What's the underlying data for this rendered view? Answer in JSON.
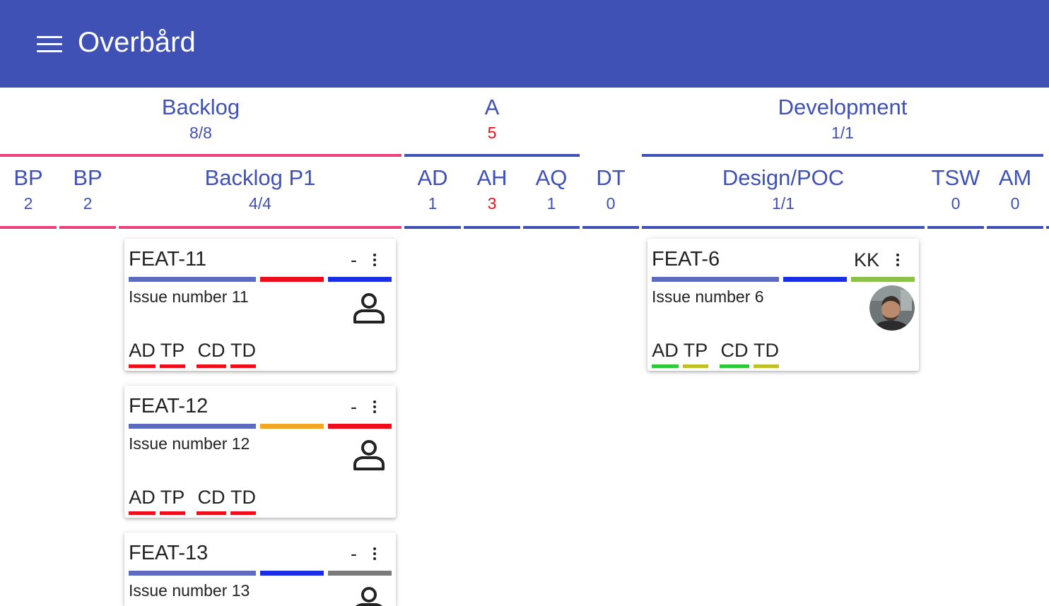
{
  "app": {
    "title": "Overbård",
    "menu_icon": "menu-icon"
  },
  "colors": {
    "primary": "#3f51b5",
    "header_text": "#ffffff",
    "backlog_accent": "#ec407a",
    "alert_red": "#f10c1c"
  },
  "groups": [
    {
      "name": "Backlog",
      "count": "8/8"
    },
    {
      "name": "A",
      "count": "5"
    },
    {
      "name": "Development",
      "count": "1/1"
    }
  ],
  "columns": [
    {
      "name": "BP",
      "count": "2"
    },
    {
      "name": "BP",
      "count": "2"
    },
    {
      "name": "Backlog P1",
      "count": "4/4"
    },
    {
      "name": "AD",
      "count": "1"
    },
    {
      "name": "AH",
      "count": "3"
    },
    {
      "name": "AQ",
      "count": "1"
    },
    {
      "name": "DT",
      "count": "0"
    },
    {
      "name": "Design/POC",
      "count": "1/1"
    },
    {
      "name": "TSW",
      "count": "0"
    },
    {
      "name": "AM",
      "count": "0"
    }
  ],
  "cards": [
    {
      "id": "FEAT-11",
      "assignee": "-",
      "description": "Issue number 11",
      "avatar": "person-icon",
      "bar_colors": [
        "#5c6bc0",
        "#f10c1c",
        "#1a2ee8"
      ],
      "tasks": [
        {
          "label": "AD",
          "color": "#f10c1c"
        },
        {
          "label": "TP",
          "color": "#f10c1c"
        },
        {
          "label": "CD",
          "color": "#f10c1c"
        },
        {
          "label": "TD",
          "color": "#f10c1c"
        }
      ]
    },
    {
      "id": "FEAT-12",
      "assignee": "-",
      "description": "Issue number 12",
      "avatar": "person-icon",
      "bar_colors": [
        "#5c6bc0",
        "#f5a524",
        "#f10c1c"
      ],
      "tasks": [
        {
          "label": "AD",
          "color": "#f10c1c"
        },
        {
          "label": "TP",
          "color": "#f10c1c"
        },
        {
          "label": "CD",
          "color": "#f10c1c"
        },
        {
          "label": "TD",
          "color": "#f10c1c"
        }
      ]
    },
    {
      "id": "FEAT-13",
      "assignee": "-",
      "description": "Issue number 13",
      "avatar": "person-icon",
      "bar_colors": [
        "#5c6bc0",
        "#1a2ee8",
        "#7b7b7b"
      ]
    },
    {
      "id": "FEAT-6",
      "assignee": "KK",
      "description": "Issue number 6",
      "avatar": "user-photo",
      "bar_colors": [
        "#5c6bc0",
        "#1a2ee8",
        "#8bc34a"
      ],
      "tasks": [
        {
          "label": "AD",
          "color": "#2fc836"
        },
        {
          "label": "TP",
          "color": "#bfbf27"
        },
        {
          "label": "CD",
          "color": "#2fc836"
        },
        {
          "label": "TD",
          "color": "#bfbf27"
        }
      ]
    }
  ]
}
